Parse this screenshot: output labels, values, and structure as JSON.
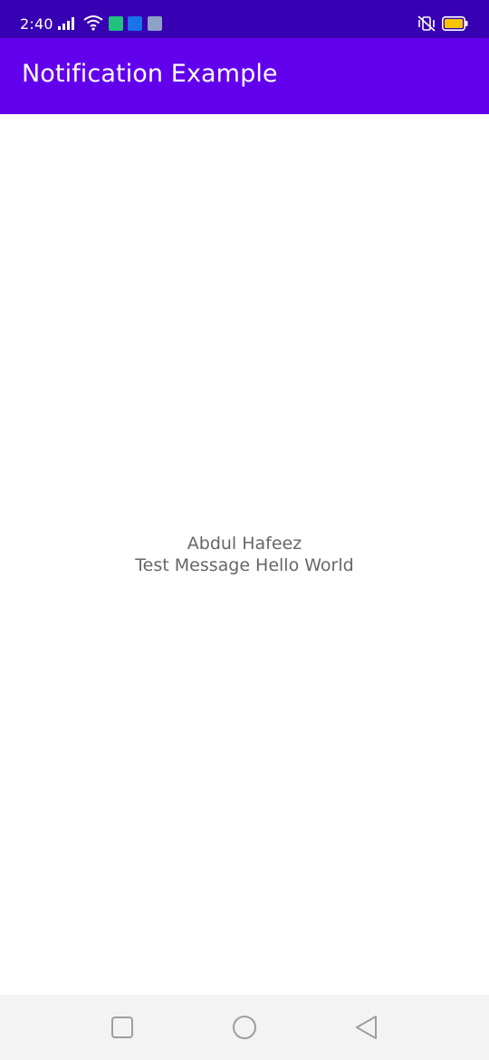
{
  "status_bar": {
    "time": "2:40",
    "icons": [
      "signal-icon",
      "wifi-icon",
      "android-icon",
      "vpn-icon",
      "drive-icon",
      "vibrate-icon",
      "battery-icon"
    ],
    "bar_color": "#3700b3"
  },
  "app_bar": {
    "title": "Notification Example",
    "color": "#6200ee"
  },
  "main": {
    "name": "Abdul Hafeez",
    "message": "Test Message Hello World"
  },
  "nav_bar": {
    "buttons": [
      "recents-button",
      "home-button",
      "back-button"
    ]
  }
}
